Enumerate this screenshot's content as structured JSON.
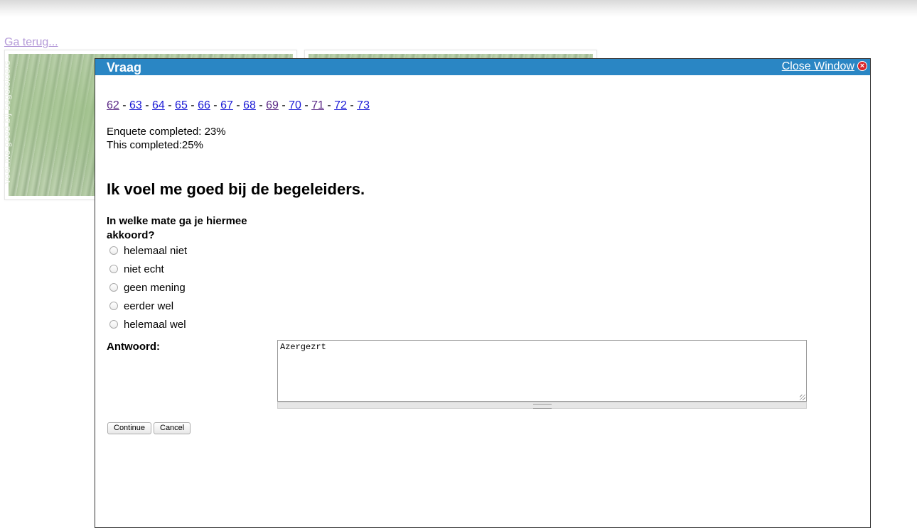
{
  "page": {
    "back_link": "Ga terug...",
    "thumbnail_caption": "voel me goed bij begeleiders"
  },
  "modal": {
    "title": "Vraag",
    "close_label": "Close Window",
    "pages": [
      {
        "label": "62",
        "visited": true
      },
      {
        "label": "63",
        "visited": false
      },
      {
        "label": "64",
        "visited": false
      },
      {
        "label": "65",
        "visited": false
      },
      {
        "label": "66",
        "visited": false
      },
      {
        "label": "67",
        "visited": false
      },
      {
        "label": "68",
        "visited": false
      },
      {
        "label": "69",
        "visited": true
      },
      {
        "label": "70",
        "visited": false
      },
      {
        "label": "71",
        "visited": true
      },
      {
        "label": "72",
        "visited": false
      },
      {
        "label": "73",
        "visited": false
      }
    ],
    "page_separator": " - ",
    "enquete_completed": "Enquete completed: 23%",
    "this_completed": "This completed:25%",
    "question_title": "Ik voel me goed bij de begeleiders.",
    "sub_question": "In welke mate ga je hiermee akkoord?",
    "options": [
      "helemaal niet",
      "niet echt",
      "geen mening",
      "eerder wel",
      "helemaal wel"
    ],
    "answer_label": "Antwoord:",
    "answer_value": "Azergezrt",
    "continue_label": "Continue",
    "cancel_label": "Cancel"
  },
  "colors": {
    "header_bg": "#2a86c4",
    "link": "#1a1ad6",
    "visited_link": "#5c2a86",
    "back_link": "#b49ad8"
  }
}
